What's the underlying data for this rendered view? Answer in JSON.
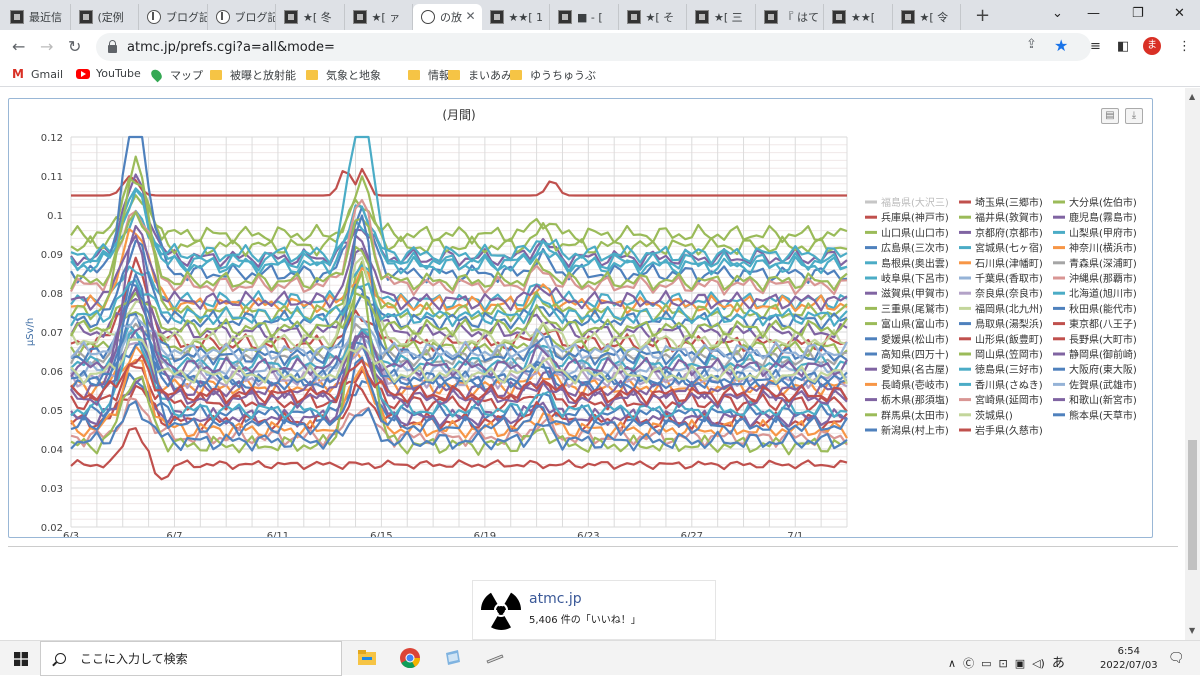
{
  "browser": {
    "tabs": [
      {
        "label": "最近信",
        "icon": "atmc-favicon"
      },
      {
        "label": "(定例",
        "icon": "atmc-favicon"
      },
      {
        "label": "ブログ記",
        "icon": "blog-favicon"
      },
      {
        "label": "ブログ記",
        "icon": "blog-favicon"
      },
      {
        "label": "★[ 冬",
        "icon": "atmc-favicon"
      },
      {
        "label": "★[ ァ",
        "icon": "atmc-favicon"
      },
      {
        "label": "の放",
        "icon": "globe-favicon",
        "active": true
      },
      {
        "label": "★★[ 1",
        "icon": "atmc-favicon"
      },
      {
        "label": "■ - [",
        "icon": "atmc-favicon"
      },
      {
        "label": "★[ そ",
        "icon": "atmc-favicon"
      },
      {
        "label": "★[ 三",
        "icon": "atmc-favicon"
      },
      {
        "label": "『 はて",
        "icon": "atmc-favicon"
      },
      {
        "label": "★★[",
        "icon": "atmc-favicon"
      },
      {
        "label": "★[ 令",
        "icon": "atmc-favicon"
      }
    ],
    "url": "atmc.jp/prefs.cgi?a=all&mode=",
    "profile_initial": "ま",
    "bookmarks": [
      "Gmail",
      "YouTube",
      "マップ",
      "被曝と放射能",
      "気象と地象",
      "情報",
      "まいあみ",
      "ゆうちゅうぶ"
    ]
  },
  "chart_data": {
    "type": "line",
    "title": "(月間)",
    "ylabel": "μSv/h",
    "xlabel": "",
    "ylim": [
      0.02,
      0.12
    ],
    "yticks": [
      "0.12",
      "0.11",
      "0.1",
      "0.09",
      "0.08",
      "0.07",
      "0.06",
      "0.05",
      "0.04",
      "0.03",
      "0.02"
    ],
    "xticks": [
      "6/3",
      "6/7",
      "6/11",
      "6/15",
      "6/19",
      "6/23",
      "6/27",
      "7/1"
    ],
    "grid": true,
    "legend_position": "right",
    "series": [
      {
        "name": "福島県(大沢三)",
        "color": "#c6c6c6",
        "base": null
      },
      {
        "name": "埼玉県(三郷市)",
        "color": "#c0504d",
        "base": 0.067
      },
      {
        "name": "大分県(佐伯市)",
        "color": "#9bbb59",
        "base": 0.066
      },
      {
        "name": "兵庫県(神戸市)",
        "color": "#c0504d",
        "base": 0.105
      },
      {
        "name": "福井県(敦賀市)",
        "color": "#9bbb59",
        "base": 0.095
      },
      {
        "name": "鹿児島(霧島市)",
        "color": "#8064a2",
        "base": 0.089
      },
      {
        "name": "山口県(山口市)",
        "color": "#9bbb59",
        "base": 0.092
      },
      {
        "name": "京都府(京都市)",
        "color": "#8064a2",
        "base": 0.07
      },
      {
        "name": "山梨県(甲府市)",
        "color": "#4bacc6",
        "base": 0.09
      },
      {
        "name": "広島県(三次市)",
        "color": "#4f81bd",
        "base": 0.085
      },
      {
        "name": "宮城県(七ヶ宿)",
        "color": "#4bacc6",
        "base": 0.078
      },
      {
        "name": "神奈川(横浜市)",
        "color": "#f79646",
        "base": 0.056
      },
      {
        "name": "島根県(奥出雲)",
        "color": "#4bacc6",
        "base": 0.088
      },
      {
        "name": "石川県(津幡町)",
        "color": "#f79646",
        "base": 0.077
      },
      {
        "name": "青森県(深浦町)",
        "color": "#a5a5a5",
        "base": 0.063
      },
      {
        "name": "岐阜県(下呂市)",
        "color": "#4bacc6",
        "base": 0.087
      },
      {
        "name": "千葉県(香取市)",
        "color": "#95b3d7",
        "base": 0.06
      },
      {
        "name": "沖縄県(那覇市)",
        "color": "#d99694",
        "base": 0.082
      },
      {
        "name": "滋賀県(甲賀市)",
        "color": "#8064a2",
        "base": 0.078
      },
      {
        "name": "奈良県(奈良市)",
        "color": "#b3a2c7",
        "base": 0.058
      },
      {
        "name": "北海道(旭川市)",
        "color": "#4bacc6",
        "base": 0.062
      },
      {
        "name": "三重県(尾鷲市)",
        "color": "#9bbb59",
        "base": 0.075
      },
      {
        "name": "福岡県(北九州)",
        "color": "#c3d69b",
        "base": 0.068
      },
      {
        "name": "秋田県(能代市)",
        "color": "#4f81bd",
        "base": 0.049
      },
      {
        "name": "富山県(富山市)",
        "color": "#9bbb59",
        "base": 0.083
      },
      {
        "name": "鳥取県(湯梨浜)",
        "color": "#4f81bd",
        "base": 0.073
      },
      {
        "name": "東京都(八王子)",
        "color": "#c0504d",
        "base": 0.052
      },
      {
        "name": "愛媛県(松山市)",
        "color": "#4f81bd",
        "base": 0.057
      },
      {
        "name": "山形県(飯豊町)",
        "color": "#c0504d",
        "base": 0.047
      },
      {
        "name": "長野県(大町市)",
        "color": "#c0504d",
        "base": 0.036
      },
      {
        "name": "高知県(四万十)",
        "color": "#4f81bd",
        "base": 0.064
      },
      {
        "name": "岡山県(笠岡市)",
        "color": "#9bbb59",
        "base": 0.071
      },
      {
        "name": "静岡県(御前崎)",
        "color": "#8064a2",
        "base": 0.048
      },
      {
        "name": "愛知県(名古屋)",
        "color": "#8064a2",
        "base": 0.055
      },
      {
        "name": "徳島県(三好市)",
        "color": "#4bacc6",
        "base": 0.074
      },
      {
        "name": "大阪府(東大阪)",
        "color": "#4f81bd",
        "base": 0.058
      },
      {
        "name": "長崎県(壱岐市)",
        "color": "#f79646",
        "base": 0.045
      },
      {
        "name": "香川県(さぬき)",
        "color": "#4bacc6",
        "base": 0.05
      },
      {
        "name": "佐賀県(武雄市)",
        "color": "#95b3d7",
        "base": 0.065
      },
      {
        "name": "栃木県(那須塩)",
        "color": "#8064a2",
        "base": 0.053
      },
      {
        "name": "宮崎県(延岡市)",
        "color": "#d99694",
        "base": 0.043
      },
      {
        "name": "和歌山(新宮市)",
        "color": "#8064a2",
        "base": 0.061
      },
      {
        "name": "群馬県(太田市)",
        "color": "#9bbb59",
        "base": 0.041
      },
      {
        "name": "茨城県()",
        "color": "#c3d69b",
        "base": 0.059
      },
      {
        "name": "熊本県(天草市)",
        "color": "#4f81bd",
        "base": 0.042
      },
      {
        "name": "新潟県(村上市)",
        "color": "#4f81bd",
        "base": 0.046
      },
      {
        "name": "岩手県(久慈市)",
        "color": "#c0504d",
        "base": 0.054
      }
    ]
  },
  "facebook": {
    "site": "atmc.jp",
    "likes": "5,406 件の「いいね！」"
  },
  "taskbar": {
    "search_placeholder": "ここに入力して検索",
    "time": "6:54",
    "date": "2022/07/03",
    "ime": "あ"
  }
}
